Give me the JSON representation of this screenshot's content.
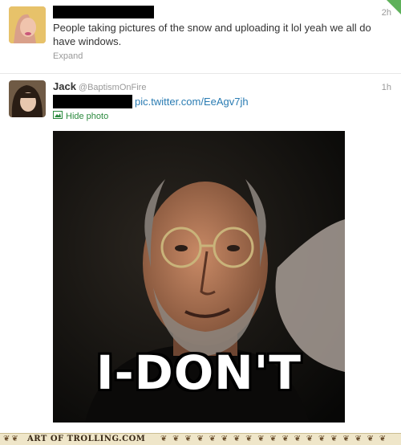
{
  "tweet1": {
    "time": "2h",
    "text": "People taking pictures of the snow and uploading it lol yeah we all do have windows.",
    "expand_label": "Expand"
  },
  "tweet2": {
    "name": "Jack",
    "handle": "@BaptismOnFire",
    "time": "1h",
    "link": "pic.twitter.com/EeAgv7jh",
    "hide_photo_label": "Hide photo",
    "photo_caption": "I-DON'T"
  },
  "footer": {
    "watermark": "ART OF TROLLING.COM"
  },
  "colors": {
    "link": "#2a7cb3",
    "hide_photo": "#2b8a3e",
    "muted": "#999999",
    "corner_badge": "#5eb15a"
  }
}
